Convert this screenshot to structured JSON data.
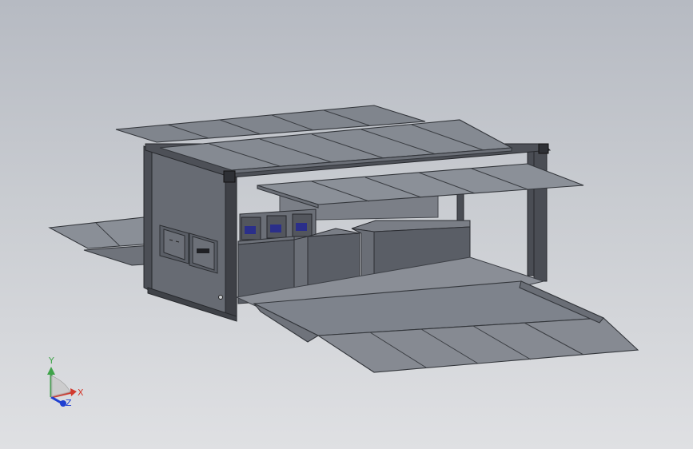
{
  "triad": {
    "x_label": "X",
    "y_label": "Y",
    "z_label": "Z",
    "colors": {
      "x": "#d23a2e",
      "y": "#3fa34a",
      "z": "#1f3fd1"
    }
  },
  "scene": {
    "background_top": "#b6bac2",
    "background_bottom": "#dfe0e3",
    "panel_color": "#7e838c",
    "panel_dark": "#5d6169",
    "frame_color": "#4a4d54",
    "box_color": "#5a5e66"
  }
}
